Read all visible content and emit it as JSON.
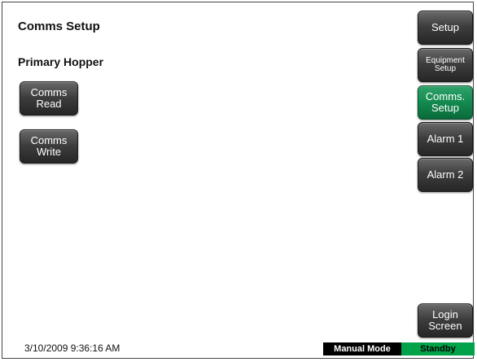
{
  "header": {
    "title": "Comms Setup"
  },
  "main": {
    "section_title": "Primary Hopper",
    "comms_read_label": "Comms\nRead",
    "comms_write_label": "Comms\nWrite"
  },
  "nav": {
    "setup": "Setup",
    "equipment_setup": "Equipment\nSetup",
    "comms_setup": "Comms.\nSetup",
    "alarm1": "Alarm 1",
    "alarm2": "Alarm 2",
    "login_screen": "Login\nScreen"
  },
  "footer": {
    "datetime": "3/10/2009 9:36:16 AM",
    "mode": "Manual Mode",
    "state": "Standby"
  },
  "colors": {
    "active_button": "#138a4f",
    "button": "#3e3e3e",
    "status_standby": "#00a24a",
    "status_mode_bg": "#000000"
  }
}
